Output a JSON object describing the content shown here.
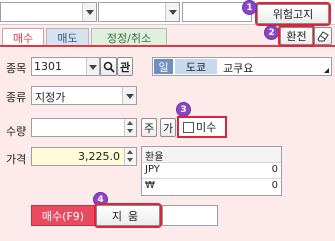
{
  "top": {
    "risk_notice_label": "위험고지",
    "exchange_label": "환전",
    "eraser_icon": "eraser-icon"
  },
  "tabs": [
    {
      "label": "매수"
    },
    {
      "label": "매도"
    },
    {
      "label": "정정/취소"
    }
  ],
  "form": {
    "stock_label": "종목",
    "stock_code": "1301",
    "search_icon": "search-icon",
    "kan_label": "관",
    "market_tag": "일",
    "exchange_name": "도쿄",
    "stock_name": "교쿠요",
    "order_type_label": "종류",
    "order_type_value": "지정가",
    "qty_label": "수량",
    "qty_value": "",
    "ju_label": "주",
    "ga_label": "가",
    "unfilled_label": "미수",
    "price_label": "가격",
    "price_value": "3,225.0",
    "fx_header": "환율",
    "fx_rows": [
      {
        "currency": "JPY",
        "value": "0"
      },
      {
        "currency": "₩",
        "value": "0"
      }
    ]
  },
  "actions": {
    "buy_label": "매수(F9)",
    "clear_label": "지움"
  },
  "badges": [
    "1",
    "2",
    "3",
    "4"
  ],
  "colors": {
    "accent": "#e84a5f",
    "highlight": "#e0223a",
    "badge": "#8a47c4",
    "background": "#fdeaea"
  }
}
